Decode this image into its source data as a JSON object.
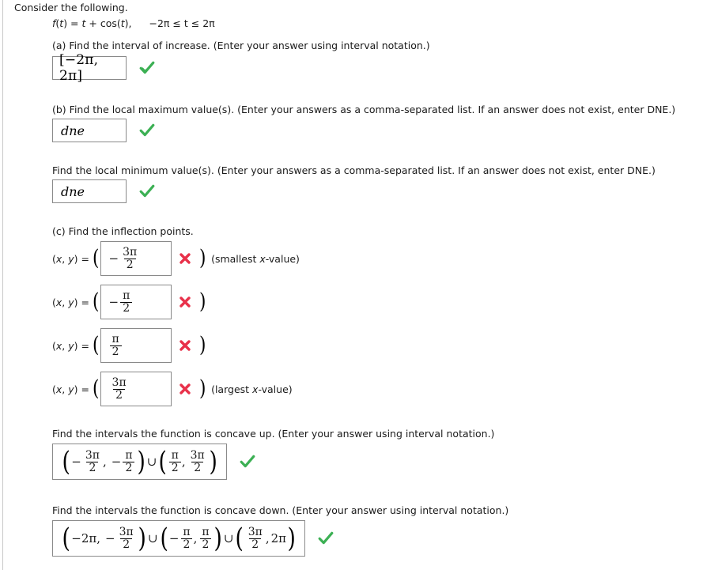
{
  "page": {
    "intro": "Consider the following.",
    "function_line": {
      "fname": "f",
      "var": "t",
      "expr_prefix": "(",
      "full": "f(t) = t + cos(t),",
      "domain": "−2π ≤ t ≤ 2π"
    }
  },
  "parts": {
    "a": {
      "prompt": "(a) Find the interval of increase. (Enter your answer using interval notation.)",
      "answer": "[−2π, 2π]",
      "status": "correct"
    },
    "b_max": {
      "prompt": "(b) Find the local maximum value(s). (Enter your answers as a comma-separated list. If an answer does not exist, enter DNE.)",
      "answer": "dne",
      "status": "correct"
    },
    "b_min": {
      "prompt": "Find the local minimum value(s). (Enter your answers as a comma-separated list. If an answer does not exist, enter DNE.)",
      "answer": "dne",
      "status": "correct"
    },
    "c": {
      "prompt": "(c) Find the inflection points.",
      "coord_label": "(x, y) =",
      "rows": [
        {
          "sign": "−",
          "num": "3π",
          "den": "2",
          "status": "incorrect",
          "note": "(smallest x-value)"
        },
        {
          "sign": "−",
          "num": "π",
          "den": "2",
          "status": "incorrect",
          "note": ""
        },
        {
          "sign": "",
          "num": "π",
          "den": "2",
          "status": "incorrect",
          "note": ""
        },
        {
          "sign": "",
          "num": "3π",
          "den": "2",
          "status": "incorrect",
          "note": "(largest x-value)"
        }
      ]
    },
    "concave_up": {
      "prompt": "Find the intervals the function is concave up. (Enter your answer using interval notation.)",
      "answer": "(−3π/2, −π/2) ∪ (π/2, 3π/2)",
      "status": "correct"
    },
    "concave_down": {
      "prompt": "Find the intervals the function is concave down. (Enter your answer using interval notation.)",
      "answer": "(−2π, −3π/2) ∪ (−π/2, π/2) ∪ (3π/2, 2π)",
      "status": "correct"
    }
  },
  "symbols": {
    "correct_mark": "check-mark",
    "incorrect_mark": "cross-mark",
    "union": "∪",
    "minus": "−",
    "pi": "π",
    "two_pi": "2π",
    "three_pi": "3π",
    "denominator_two": "2",
    "open_paren": "(",
    "close_paren": ")",
    "comma": ",",
    "open_bracket": "[",
    "close_bracket": "]"
  },
  "colors": {
    "correct": "#3cb054",
    "incorrect": "#e8314a",
    "box_border": "#8a8a8a",
    "text": "#1a1a1a",
    "rule": "#c9c9c9",
    "background": "#ffffff"
  }
}
